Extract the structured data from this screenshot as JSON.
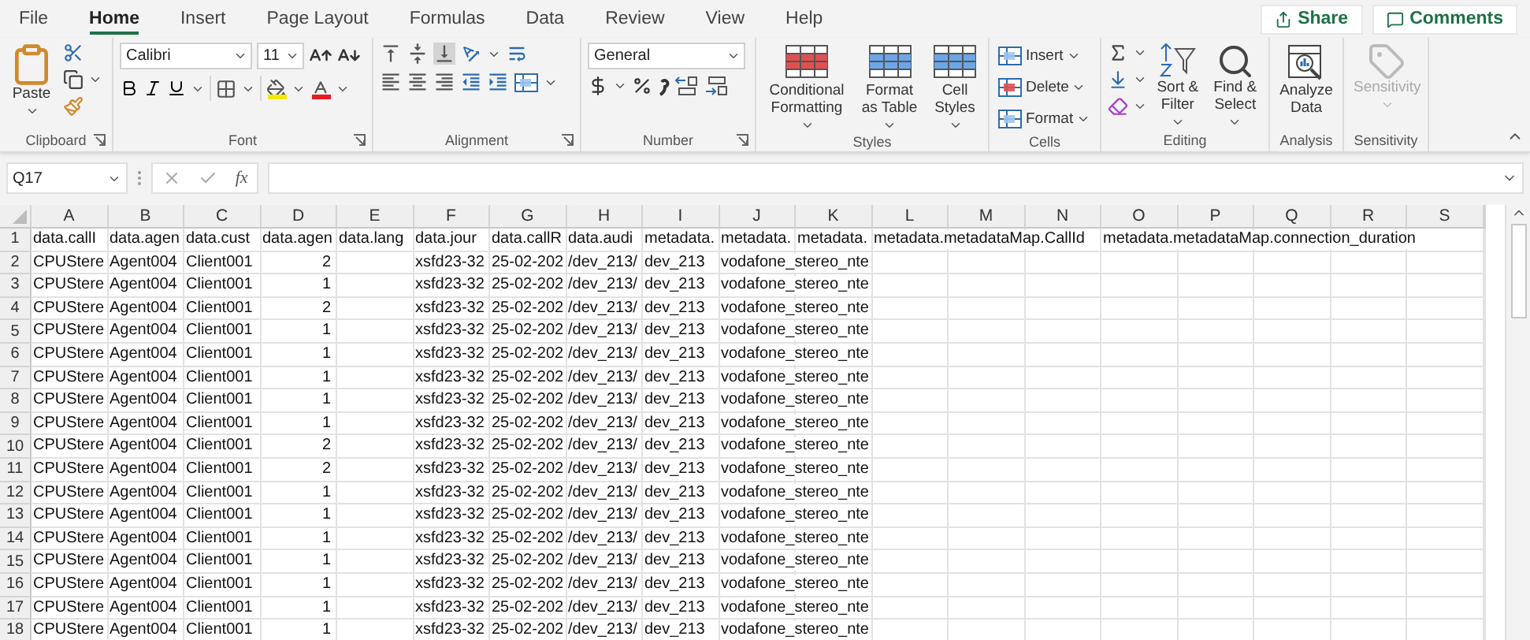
{
  "menu_tabs": [
    {
      "label": "File",
      "selected": false
    },
    {
      "label": "Home",
      "selected": true
    },
    {
      "label": "Insert",
      "selected": false
    },
    {
      "label": "Page Layout",
      "selected": false
    },
    {
      "label": "Formulas",
      "selected": false
    },
    {
      "label": "Data",
      "selected": false
    },
    {
      "label": "Review",
      "selected": false
    },
    {
      "label": "View",
      "selected": false
    },
    {
      "label": "Help",
      "selected": false
    }
  ],
  "top_buttons": [
    {
      "kind": "share",
      "label": "Share"
    },
    {
      "kind": "comments",
      "label": "Comments"
    }
  ],
  "ribbon_groups": [
    {
      "kind": "clipboard",
      "label": "Clipboard",
      "buttons": [
        "Paste"
      ]
    },
    {
      "kind": "font",
      "label": "Font",
      "font_name": "Calibri",
      "font_size": "11"
    },
    {
      "kind": "alignment",
      "label": "Alignment"
    },
    {
      "kind": "number",
      "label": "Number",
      "format": "General"
    },
    {
      "kind": "styles",
      "label": "Styles",
      "buttons": [
        "Conditional Formatting",
        "Format as Table",
        "Cell Styles"
      ]
    },
    {
      "kind": "cells",
      "label": "Cells",
      "buttons": [
        "Insert",
        "Delete",
        "Format"
      ]
    },
    {
      "kind": "editing",
      "label": "Editing",
      "buttons": [
        "Sort & Filter",
        "Find & Select"
      ]
    },
    {
      "kind": "analysis",
      "label": "Analysis",
      "buttons": [
        "Analyze Data"
      ]
    },
    {
      "kind": "sensitivity",
      "label": "Sensitivity",
      "buttons": [
        "Sensitivity"
      ],
      "disabled": true
    }
  ],
  "formula_bar": {
    "name_box": "Q17",
    "function_label": "fx"
  },
  "columns": [
    "A",
    "B",
    "C",
    "D",
    "E",
    "F",
    "G",
    "H",
    "I",
    "J",
    "K",
    "L",
    "M",
    "N",
    "O",
    "P",
    "Q",
    "R",
    "S"
  ],
  "rows": [
    {
      "number": "1",
      "cells": {
        "A": "data.callI",
        "B": "data.agen",
        "C": "data.cust",
        "D": "data.agen",
        "E": "data.lang",
        "F": "data.jour",
        "G": "data.callR",
        "H": "data.audi",
        "I": "metadata.",
        "J": "metadata.",
        "K": "metadata.",
        "L": "metadata.metadataMap.CallId",
        "O": "metadata.metadataMap.connection_duration"
      }
    },
    {
      "number": "2",
      "cells": {
        "A": "CPUStere",
        "B": "Agent004",
        "C": "Client001",
        "D": {
          "text": "2",
          "kind": "number"
        },
        "F": "xsfd23-32",
        "G": "25-02-202",
        "H": "/dev_213/",
        "I": "dev_213",
        "J": "vodafone_stereo_nte"
      }
    },
    {
      "number": "3",
      "cells": {
        "A": "CPUStere",
        "B": "Agent004",
        "C": "Client001",
        "D": {
          "text": "1",
          "kind": "number"
        },
        "F": "xsfd23-32",
        "G": "25-02-202",
        "H": "/dev_213/",
        "I": "dev_213",
        "J": "vodafone_stereo_nte"
      }
    },
    {
      "number": "4",
      "cells": {
        "A": "CPUStere",
        "B": "Agent004",
        "C": "Client001",
        "D": {
          "text": "2",
          "kind": "number"
        },
        "F": "xsfd23-32",
        "G": "25-02-202",
        "H": "/dev_213/",
        "I": "dev_213",
        "J": "vodafone_stereo_nte"
      }
    },
    {
      "number": "5",
      "cells": {
        "A": "CPUStere",
        "B": "Agent004",
        "C": "Client001",
        "D": {
          "text": "1",
          "kind": "number"
        },
        "F": "xsfd23-32",
        "G": "25-02-202",
        "H": "/dev_213/",
        "I": "dev_213",
        "J": "vodafone_stereo_nte"
      }
    },
    {
      "number": "6",
      "cells": {
        "A": "CPUStere",
        "B": "Agent004",
        "C": "Client001",
        "D": {
          "text": "1",
          "kind": "number"
        },
        "F": "xsfd23-32",
        "G": "25-02-202",
        "H": "/dev_213/",
        "I": "dev_213",
        "J": "vodafone_stereo_nte"
      }
    },
    {
      "number": "7",
      "cells": {
        "A": "CPUStere",
        "B": "Agent004",
        "C": "Client001",
        "D": {
          "text": "1",
          "kind": "number"
        },
        "F": "xsfd23-32",
        "G": "25-02-202",
        "H": "/dev_213/",
        "I": "dev_213",
        "J": "vodafone_stereo_nte"
      }
    },
    {
      "number": "8",
      "cells": {
        "A": "CPUStere",
        "B": "Agent004",
        "C": "Client001",
        "D": {
          "text": "1",
          "kind": "number"
        },
        "F": "xsfd23-32",
        "G": "25-02-202",
        "H": "/dev_213/",
        "I": "dev_213",
        "J": "vodafone_stereo_nte"
      }
    },
    {
      "number": "9",
      "cells": {
        "A": "CPUStere",
        "B": "Agent004",
        "C": "Client001",
        "D": {
          "text": "1",
          "kind": "number"
        },
        "F": "xsfd23-32",
        "G": "25-02-202",
        "H": "/dev_213/",
        "I": "dev_213",
        "J": "vodafone_stereo_nte"
      }
    },
    {
      "number": "10",
      "cells": {
        "A": "CPUStere",
        "B": "Agent004",
        "C": "Client001",
        "D": {
          "text": "2",
          "kind": "number"
        },
        "F": "xsfd23-32",
        "G": "25-02-202",
        "H": "/dev_213/",
        "I": "dev_213",
        "J": "vodafone_stereo_nte"
      }
    },
    {
      "number": "11",
      "cells": {
        "A": "CPUStere",
        "B": "Agent004",
        "C": "Client001",
        "D": {
          "text": "2",
          "kind": "number"
        },
        "F": "xsfd23-32",
        "G": "25-02-202",
        "H": "/dev_213/",
        "I": "dev_213",
        "J": "vodafone_stereo_nte"
      }
    },
    {
      "number": "12",
      "cells": {
        "A": "CPUStere",
        "B": "Agent004",
        "C": "Client001",
        "D": {
          "text": "1",
          "kind": "number"
        },
        "F": "xsfd23-32",
        "G": "25-02-202",
        "H": "/dev_213/",
        "I": "dev_213",
        "J": "vodafone_stereo_nte"
      }
    },
    {
      "number": "13",
      "cells": {
        "A": "CPUStere",
        "B": "Agent004",
        "C": "Client001",
        "D": {
          "text": "1",
          "kind": "number"
        },
        "F": "xsfd23-32",
        "G": "25-02-202",
        "H": "/dev_213/",
        "I": "dev_213",
        "J": "vodafone_stereo_nte"
      }
    },
    {
      "number": "14",
      "cells": {
        "A": "CPUStere",
        "B": "Agent004",
        "C": "Client001",
        "D": {
          "text": "1",
          "kind": "number"
        },
        "F": "xsfd23-32",
        "G": "25-02-202",
        "H": "/dev_213/",
        "I": "dev_213",
        "J": "vodafone_stereo_nte"
      }
    },
    {
      "number": "15",
      "cells": {
        "A": "CPUStere",
        "B": "Agent004",
        "C": "Client001",
        "D": {
          "text": "1",
          "kind": "number"
        },
        "F": "xsfd23-32",
        "G": "25-02-202",
        "H": "/dev_213/",
        "I": "dev_213",
        "J": "vodafone_stereo_nte"
      }
    },
    {
      "number": "16",
      "cells": {
        "A": "CPUStere",
        "B": "Agent004",
        "C": "Client001",
        "D": {
          "text": "1",
          "kind": "number"
        },
        "F": "xsfd23-32",
        "G": "25-02-202",
        "H": "/dev_213/",
        "I": "dev_213",
        "J": "vodafone_stereo_nte"
      }
    },
    {
      "number": "17",
      "cells": {
        "A": "CPUStere",
        "B": "Agent004",
        "C": "Client001",
        "D": {
          "text": "1",
          "kind": "number"
        },
        "F": "xsfd23-32",
        "G": "25-02-202",
        "H": "/dev_213/",
        "I": "dev_213",
        "J": "vodafone_stereo_nte"
      }
    },
    {
      "number": "18",
      "cells": {
        "A": "CPUStere",
        "B": "Agent004",
        "C": "Client001",
        "D": {
          "text": "1",
          "kind": "number"
        },
        "F": "xsfd23-32",
        "G": "25-02-202",
        "H": "/dev_213/",
        "I": "dev_213",
        "J": "vodafone_stereo_nte"
      }
    }
  ]
}
